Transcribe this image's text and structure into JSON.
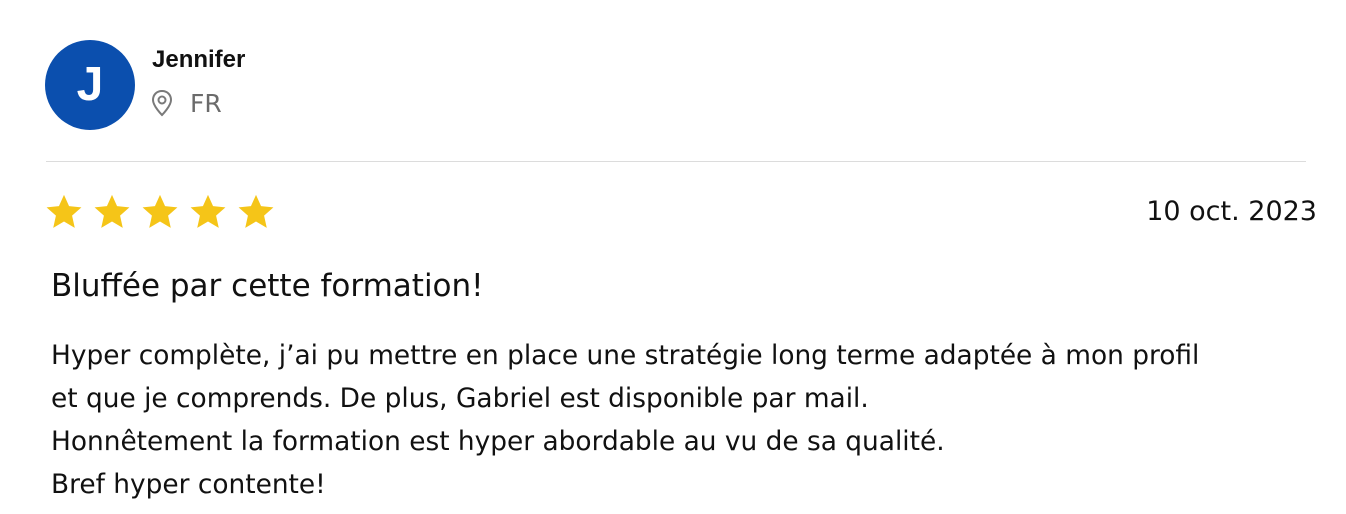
{
  "reviewer": {
    "avatar_initial": "J",
    "name": "Jennifer",
    "location_icon": "location-pin-icon",
    "country": "FR"
  },
  "review": {
    "rating": 5,
    "rating_max": 5,
    "star_icon": "star-icon",
    "date": "10 oct. 2023",
    "title": "Bluffée par cette formation!",
    "body_lines": [
      "Hyper complète, j’ai pu mettre en place une stratégie long terme adaptée à mon profil",
      "et que je comprends. De plus, Gabriel est disponible par mail.",
      "Honnêtement la formation est hyper abordable au vu de sa qualité.",
      "Bref hyper contente!"
    ]
  },
  "colors": {
    "avatar_background": "#0b4fae",
    "star_fill": "#f5c518",
    "muted_text": "#6b6b6b",
    "divider": "#dcdcdc"
  }
}
